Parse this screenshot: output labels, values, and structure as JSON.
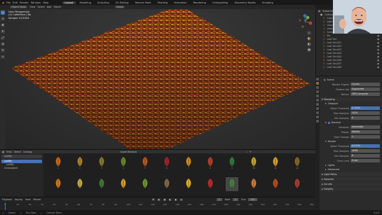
{
  "topbar": {
    "menus": [
      "File",
      "Edit",
      "Render",
      "Window",
      "Help"
    ],
    "workspaces": [
      "Layout",
      "Modeling",
      "Sculpting",
      "UV Editing",
      "Texture Paint",
      "Shading",
      "Animation",
      "Rendering",
      "Compositing",
      "Geometry Nodes",
      "Scripting"
    ],
    "active_workspace": "Layout",
    "scene": "Scene",
    "view_layer": "ViewLayer"
  },
  "viewport_header": {
    "mode": "Object Mode",
    "items": [
      "View",
      "Select",
      "Add",
      "Object"
    ],
    "transform": "Global"
  },
  "viewport_info": {
    "line1": "User Perspective",
    "line2": "(1) Collection | Bo",
    "line3": "Sample 12/1024"
  },
  "gizmo": {
    "x": "X",
    "y": "Y",
    "z": "Z"
  },
  "outliner": {
    "title": "Scene Collection",
    "items": [
      "Collection",
      "Camera",
      "Light",
      "Ground",
      "Leaves",
      "Scatter",
      "Bo",
      "Leaf Set",
      "Leaf Set.001",
      "Leaf Set.002",
      "Leaf Set.003",
      "Leaf Set.004",
      "Leaf Set.005",
      "Leaf Set.006",
      "Leaf Set.007",
      "Leaf Set.008"
    ]
  },
  "properties": {
    "scene_name": "Scene",
    "render_engine_label": "Render Engine",
    "render_engine": "Cycles",
    "feature_set_label": "Feature Set",
    "feature_set": "Supported",
    "device_label": "Device",
    "device": "GPU Compute",
    "sampling_section": "Sampling",
    "viewport_sub": "Viewport",
    "noise_threshold_label": "Noise Threshold",
    "noise_threshold": "0.1000",
    "max_samples_label": "Max Samples",
    "max_samples": "1024",
    "min_samples_label": "Min Samples",
    "min_samples": "0",
    "denoise_sub": "Denoise",
    "denoiser_label": "Denoiser",
    "denoiser": "Automatic",
    "passes_label": "Passes",
    "passes": "Albedo",
    "start_sample_label": "Start Sample",
    "start_sample": "1",
    "render_sub": "Render",
    "r_noise_threshold": "0.0100",
    "r_max_samples": "4096",
    "r_min_samples": "0",
    "time_limit_label": "Time Limit",
    "time_limit": "0 sec",
    "lights_section": "Lights",
    "advanced_section": "Advanced",
    "light_paths_section": "Light Paths",
    "volumes_section": "Volumes",
    "curves_section": "Curves",
    "simplify_section": "Simplify"
  },
  "asset_browser": {
    "header_items": [
      "View",
      "Select",
      "Catalog"
    ],
    "title": "Asset Browser",
    "library": "Leafify",
    "catalogs": [
      "Leafify",
      "Leafify",
      "Unassigned"
    ],
    "active_catalog_index": 0,
    "row1_labels": [
      "1",
      "2",
      "3",
      "4",
      "5",
      "6",
      "7",
      "8",
      "9",
      "10",
      "11",
      "12"
    ],
    "row2_labels": [
      "",
      "",
      "",
      "",
      "",
      "",
      "",
      "",
      "",
      "",
      "",
      ""
    ],
    "selected_index": 20,
    "row1_colors": [
      "#c46a1d",
      "#b9812a",
      "#8a7a2a",
      "#6a8a2a",
      "#c2561e",
      "#a8222a",
      "#d48a1a",
      "#b8402a",
      "#2f7a3a",
      "#c9a52a",
      "#d6a21f",
      "#8a6a20"
    ],
    "row2_colors": [
      "#d07a20",
      "#c9b04a",
      "#3f7a35",
      "#d4a020",
      "#6a9a30",
      "#8a6a40",
      "#e0b020",
      "#c02a2a",
      "#3a8a3a",
      "#d08030",
      "#c24a1a",
      "#b03a3a"
    ]
  },
  "timeline": {
    "menu": [
      "Playback",
      "Keying",
      "View",
      "Marker"
    ],
    "current_frame": "1",
    "start_label": "Start",
    "start": "1",
    "end_label": "End",
    "end": "250",
    "ticks": [
      "0",
      "10",
      "20",
      "30",
      "40",
      "50",
      "60",
      "70",
      "80",
      "90",
      "100",
      "110",
      "120",
      "130",
      "140",
      "150",
      "160",
      "170",
      "180",
      "190",
      "200",
      "210",
      "220",
      "230",
      "240",
      "250"
    ]
  },
  "status": {
    "left": "Select",
    "middle": "Pan View",
    "right": "Context Menu",
    "version": "3.0.0"
  }
}
